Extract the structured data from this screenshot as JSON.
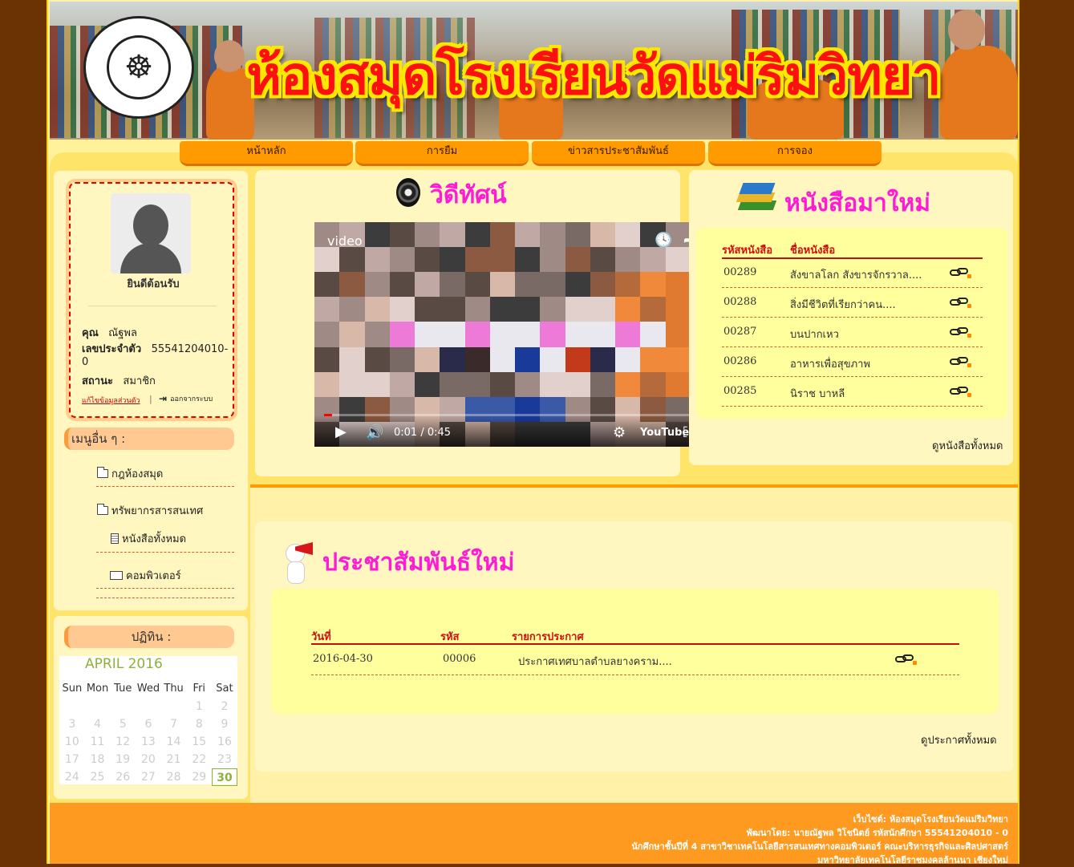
{
  "banner": {
    "title": "ห้องสมุดโรงเรียนวัดแม่ริมวิทยา"
  },
  "nav": [
    "หน้าหลัก",
    "การยืม",
    "ข่าวสารประชาสัมพันธ์",
    "การจอง"
  ],
  "user": {
    "welcome": "ยินดีต้อนรับ",
    "name_label": "คุณ",
    "name": "ณัฐพล",
    "id_label": "เลขประจำตัว",
    "id_value": "55541204010-",
    "id_value_cont": "0",
    "status_label": "สถานะ",
    "status": "สมาชิก",
    "edit_link": "แก้ไขข้อมูลส่วนตัว",
    "logout": "ออกจากระบบ"
  },
  "other_menu": {
    "title": "เมนูอื่น ๆ :",
    "items": [
      "กฎห้องสมุด",
      "ทรัพยากรสารสนเทศ",
      "หนังสือทั้งหมด",
      "คอมพิวเตอร์"
    ]
  },
  "calendar": {
    "title": "ปฏิทิน :",
    "month": "APRIL 2016",
    "days": [
      "Sun",
      "Mon",
      "Tue",
      "Wed",
      "Thu",
      "Fri",
      "Sat"
    ],
    "weeks": [
      [
        "",
        "",
        "",
        "",
        "",
        "1",
        "2"
      ],
      [
        "3",
        "4",
        "5",
        "6",
        "7",
        "8",
        "9"
      ],
      [
        "10",
        "11",
        "12",
        "13",
        "14",
        "15",
        "16"
      ],
      [
        "17",
        "18",
        "19",
        "20",
        "21",
        "22",
        "23"
      ],
      [
        "24",
        "25",
        "26",
        "27",
        "28",
        "29",
        "30"
      ]
    ],
    "today": "30"
  },
  "video_section": {
    "title": "วิดีทัศน์",
    "video_label": "video",
    "time": "0:01 / 0:45",
    "progress": 0.02
  },
  "new_books": {
    "title": "หนังสือมาใหม่",
    "col_code": "รหัสหนังสือ",
    "col_name": "ชื่อหนังสือ",
    "rows": [
      {
        "code": "00289",
        "name": "สังขาลโลก สังขารจักรวาล...."
      },
      {
        "code": "00288",
        "name": "สิ่งมีชีวิตที่เรียกว่าคน...."
      },
      {
        "code": "00287",
        "name": "บนปากเหว"
      },
      {
        "code": "00286",
        "name": "อาหารเพื่อสุขภาพ"
      },
      {
        "code": "00285",
        "name": "นิราช บาหลี"
      }
    ],
    "see_all": "ดูหนังสือทั้งหมด"
  },
  "news": {
    "title": "ประชาสัมพันธ์ใหม่",
    "col_date": "วันที่",
    "col_code": "รหัส",
    "col_item": "รายการประกาศ",
    "rows": [
      {
        "date": "2016-04-30",
        "code": "00006",
        "item": "ประกาศเทศบาลตำบลยางคราม...."
      }
    ],
    "see_all": "ดูประกาศทั้งหมด"
  },
  "footer": {
    "line1": "เว็บไซต์: ห้องสมุดโรงเรียนวัดแม่ริมวิทยา",
    "line2": "พัฒนาโดย: นายณัฐพล วิโชนิตย์ รหัสนักศึกษา 55541204010 - 0",
    "line3": "นักศึกษาชั้นปีที่ 4 สาขาวิชาเทคโนโลยีสารสนเทศทางคอมพิวเตอร์ คณะบริหารธุรกิจและศิลปศาสตร์",
    "line4": "มหาวิทยาลัยเทคโนโลยีราชมงคลล้านนา เชียงใหม่"
  },
  "colors": {
    "accent": "#ff9a00",
    "title_pink": "#ff1ad6",
    "page_bg": "#6b3304",
    "header_red": "#d01010"
  }
}
